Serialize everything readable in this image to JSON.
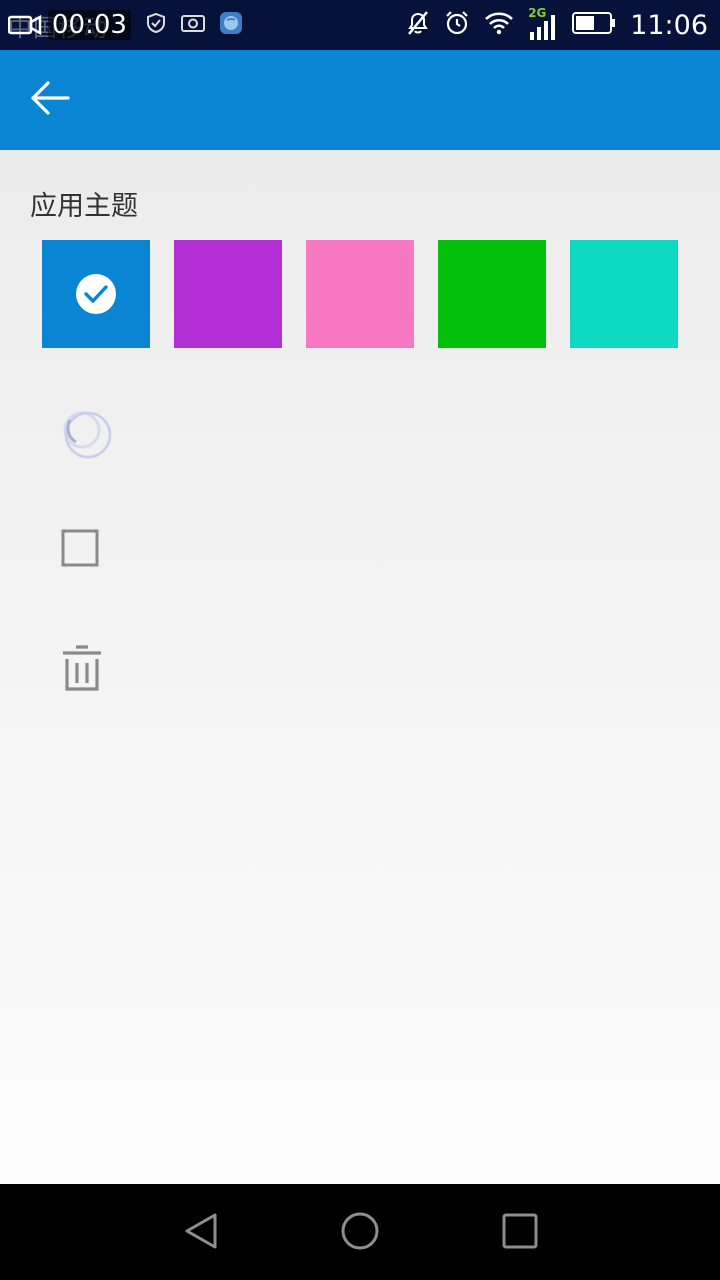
{
  "status_bar": {
    "carrier": "中国移动",
    "recording_timer": "00:03",
    "network_type": "2G",
    "clock": "11:06",
    "icons": [
      "screen-record-icon",
      "shield-icon",
      "camera-icon",
      "app-globe-icon",
      "mute-icon",
      "alarm-icon",
      "wifi-icon",
      "signal-icon",
      "battery-icon"
    ]
  },
  "app_bar": {
    "color": "#0a85d4",
    "back_icon": "back-arrow-icon"
  },
  "theme_section": {
    "title": "应用主题",
    "swatches": [
      {
        "name": "blue",
        "color": "#0a85d4",
        "selected": true
      },
      {
        "name": "purple",
        "color": "#b22fd6",
        "selected": false
      },
      {
        "name": "pink",
        "color": "#f777c3",
        "selected": false
      },
      {
        "name": "green",
        "color": "#03c00b",
        "selected": false
      },
      {
        "name": "teal",
        "color": "#0fd9c1",
        "selected": false
      }
    ]
  },
  "tools": [
    {
      "icon": "loading-spinner-icon"
    },
    {
      "icon": "checkbox-icon"
    },
    {
      "icon": "trash-icon"
    }
  ],
  "nav_bar": {
    "buttons": [
      "back-triangle-icon",
      "home-circle-icon",
      "recents-square-icon"
    ]
  }
}
